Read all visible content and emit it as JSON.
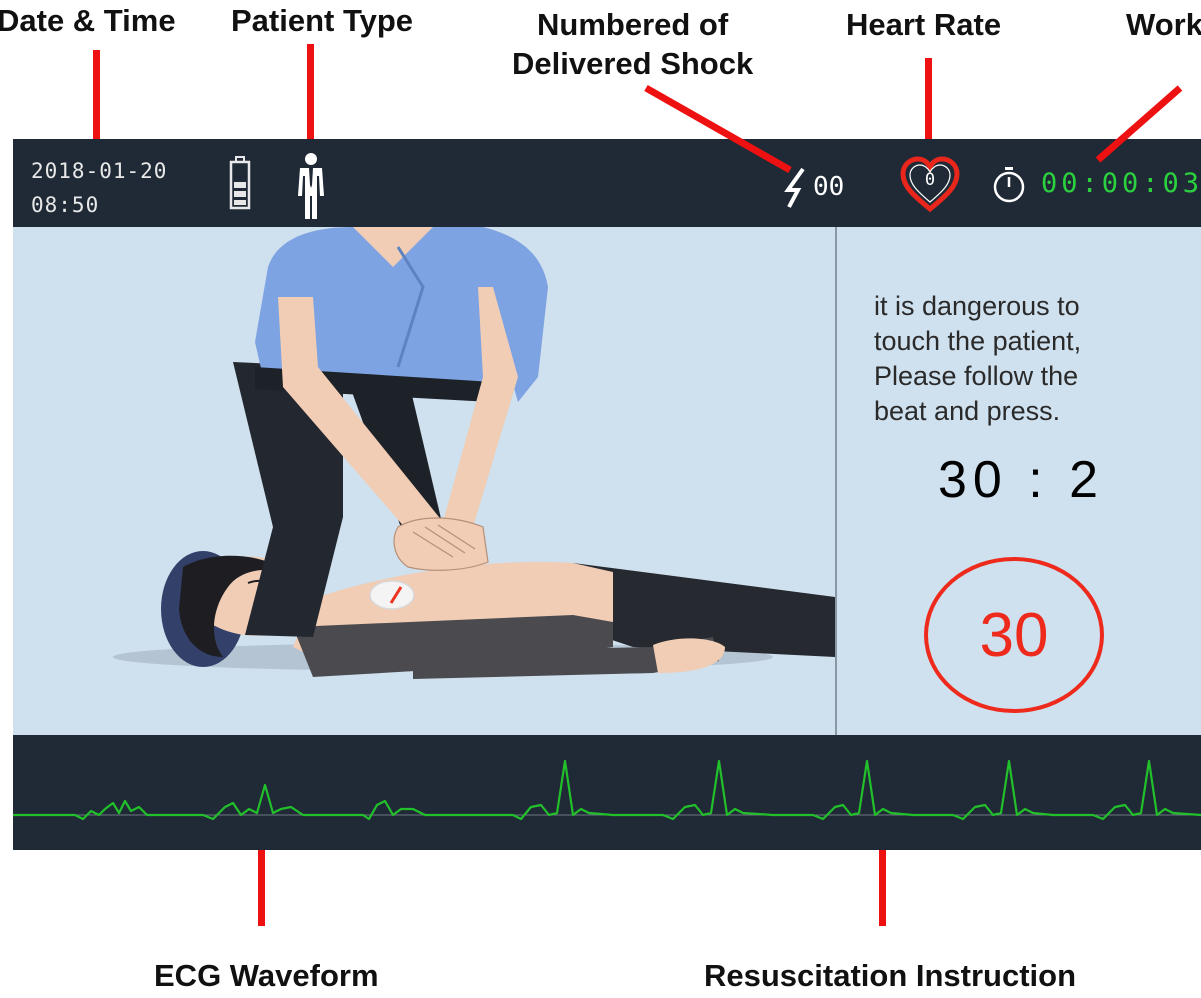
{
  "callouts": {
    "date_time": "Date & Time",
    "patient_type": "Patient Type",
    "shocks_line1": "Numbered of",
    "shocks_line2": "Delivered Shock",
    "heart_rate": "Heart Rate",
    "work_time": "Work",
    "ecg": "ECG Waveform",
    "instruction": "Resuscitation Instruction"
  },
  "status_bar": {
    "date": "2018-01-20",
    "time": "08:50",
    "battery_icon": "battery-icon",
    "patient_icon": "adult-patient-icon",
    "shock_icon": "lightning-bolt-icon",
    "shock_count": "00",
    "heart_icon": "heart-icon",
    "heart_rate": "0",
    "timer_icon": "stopwatch-icon",
    "work_timer": "00:00:03"
  },
  "instruction": {
    "text_lines": [
      "it is dangerous to",
      "touch the patient,",
      "Please follow the",
      "beat and press."
    ],
    "ratio": "30 : 2",
    "compression_count": "30"
  },
  "colors": {
    "bar_background": "#1f2a36",
    "screen_background": "#cfe0ee",
    "timer_green": "#2bd13e",
    "alert_red": "#ee2a1c",
    "ecg_green": "#22c02a",
    "pointer_red": "#ee1111"
  }
}
